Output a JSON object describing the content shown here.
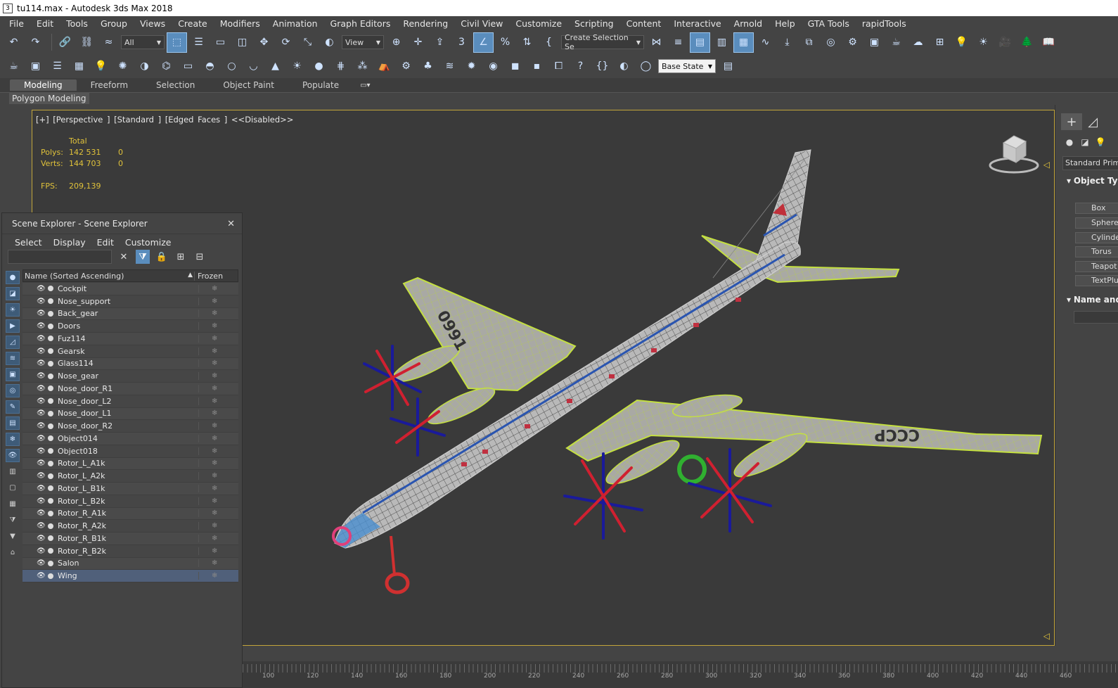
{
  "window": {
    "title": "tu114.max - Autodesk 3ds Max 2018"
  },
  "menu": [
    "File",
    "Edit",
    "Tools",
    "Group",
    "Views",
    "Create",
    "Modifiers",
    "Animation",
    "Graph Editors",
    "Rendering",
    "Civil View",
    "Customize",
    "Scripting",
    "Content",
    "Interactive",
    "Arnold",
    "Help",
    "GTA Tools",
    "rapidTools"
  ],
  "toolbar": {
    "selection_filter": "All",
    "ref_coord": "View",
    "named_selection": "Create Selection Se",
    "state_set": "Base State"
  },
  "ribbon": {
    "tabs": [
      "Modeling",
      "Freeform",
      "Selection",
      "Object Paint",
      "Populate"
    ],
    "panel_label": "Polygon Modeling"
  },
  "viewport": {
    "label": "[+] [Perspective ] [Standard ] [Edged Faces ]  <<Disabled>>",
    "stats": {
      "header": "Total",
      "polys_label": "Polys:",
      "polys_total": "142 531",
      "polys_sel": "0",
      "verts_label": "Verts:",
      "verts_total": "144 703",
      "verts_sel": "0",
      "fps_label": "FPS:",
      "fps_value": "209,139"
    },
    "wing_text_left": "0991",
    "wing_text_right": "CCCP"
  },
  "command_panel": {
    "dropdown": "Standard Primitives",
    "rollout_object": "Object Type",
    "rollout_name": "Name and Color",
    "buttons": [
      "Box",
      "Sphere",
      "Cylinder",
      "Torus",
      "Teapot",
      "TextPlus"
    ]
  },
  "scene_explorer": {
    "title": "Scene Explorer - Scene Explorer",
    "menu": [
      "Select",
      "Display",
      "Edit",
      "Customize"
    ],
    "col_name": "Name (Sorted Ascending)",
    "col_frozen": "Frozen",
    "objects": [
      "Cockpit",
      "Nose_support",
      "Back_gear",
      "Doors",
      "Fuz114",
      "Gearsk",
      "Glass114",
      "Nose_gear",
      "Nose_door_R1",
      "Nose_door_L2",
      "Nose_door_L1",
      "Nose_door_R2",
      "Object014",
      "Object018",
      "Rotor_L_A1k",
      "Rotor_L_A2k",
      "Rotor_L_B1k",
      "Rotor_L_B2k",
      "Rotor_R_A1k",
      "Rotor_R_A2k",
      "Rotor_R_B1k",
      "Rotor_R_B2k",
      "Salon",
      "Wing"
    ],
    "selected_index": 23
  },
  "timeline": {
    "ticks": [
      "100",
      "120",
      "140",
      "160",
      "180",
      "200",
      "220",
      "240",
      "260",
      "280",
      "300",
      "320",
      "340",
      "360",
      "380",
      "400",
      "420",
      "440",
      "460"
    ]
  }
}
